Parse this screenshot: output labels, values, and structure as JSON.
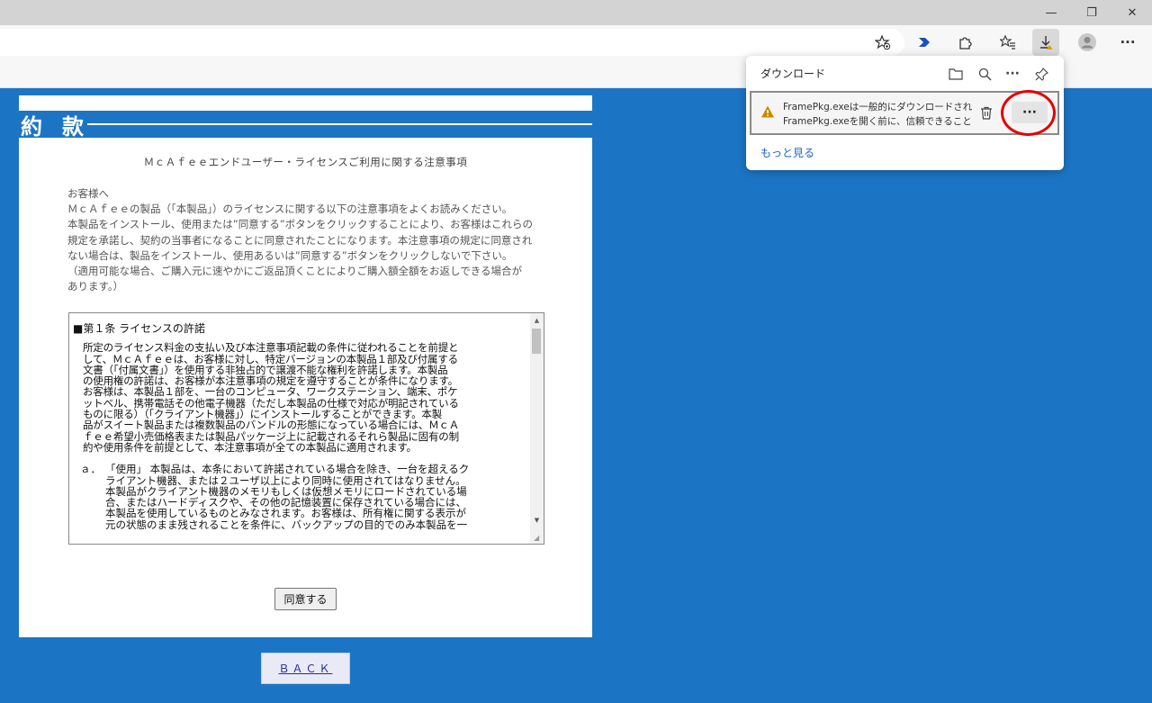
{
  "browser": {
    "window_controls": {
      "minimize": "—",
      "restore": "❐",
      "close": "✕"
    },
    "toolbar_icons": [
      "favorite-add-icon",
      "bing-icon",
      "extensions-icon",
      "favorites-icon",
      "downloads-icon",
      "profile-icon",
      "more-icon"
    ],
    "menu_label": "···"
  },
  "page": {
    "heading": "約款",
    "notice_title": "ＭｃＡｆｅｅエンドユーザー・ライセンスご利用に関する注意事項",
    "intro_lines": [
      "お客様へ",
      "ＭｃＡｆｅｅの製品（「本製品」）のライセンスに関する以下の注意事項をよくお読みください。",
      "本製品をインストール、使用または”同意する”ボタンをクリックすることにより、お客様はこれらの",
      "規定を承諾し、契約の当事者になることに同意されたことになります。本注意事項の規定に同意され",
      "ない場合は、製品をインストール、使用あるいは”同意する”ボタンをクリックしないで下さい。",
      "（適用可能な場合、ご購入元に速やかにご返品頂くことによりご購入額全額をお返しできる場合が",
      "あります。）"
    ],
    "license": {
      "section_title": "■第１条 ライセンスの許諾",
      "paragraph_lines": [
        "所定のライセンス料金の支払い及び本注意事項記載の条件に従われることを前提と",
        "して、ＭｃＡｆｅｅは、お客様に対し、特定バージョンの本製品１部及び付属する",
        "文書（「付属文書」）を使用する非独占的で譲渡不能な権利を許諾します。本製品",
        "の使用権の許諾は、お客様が本注意事項の規定を遵守することが条件になります。",
        "お客様は、本製品１部を、一台のコンピュータ、ワークステーション、端末、ポケ",
        "ットベル、携帯電話その他電子機器（ただし本製品の仕様で対応が明記されている",
        "ものに限る）（「クライアント機器」）にインストールすることができます。本製",
        "品がスイート製品または複数製品のバンドルの形態になっている場合には、ＭｃＡ",
        "ｆｅｅ希望小売価格表または製品パッケージ上に記載されるそれら製品に固有の制",
        "約や使用条件を前提として、本注意事項が全ての本製品に適用されます。"
      ],
      "item_marker": "ａ．",
      "item_lines": [
        "「使用」 本製品は、本条において許諾されている場合を除き、一台を超えるク",
        "ライアント機器、または２ユーザ以上により同時に使用されてはなりません。",
        "本製品がクライアント機器のメモリもしくは仮想メモリにロードされている場",
        "合、またはハードディスクや、その他の記憶装置に保存されている場合には、",
        "本製品を使用しているものとみなされます。お客様は、所有権に関する表示が",
        "元の状態のまま残されることを条件に、バックアップの目的でのみ本製品を一"
      ]
    },
    "agree_button": "同意する",
    "back_button": "ＢＡＣＫ"
  },
  "downloads": {
    "title": "ダウンロード",
    "header_icons": [
      "folder-icon",
      "search-icon",
      "more-icon",
      "pin-icon"
    ],
    "item": {
      "line1": "FramePkg.exeは一般的にダウンロードされて",
      "line2": "FramePkg.exeを開く前に、信頼できることを"
    },
    "more_label": "···",
    "see_more": "もっと見る",
    "colors": {
      "warning": "#c58a00",
      "highlight": "#e40000",
      "link": "#1a64c2"
    }
  }
}
